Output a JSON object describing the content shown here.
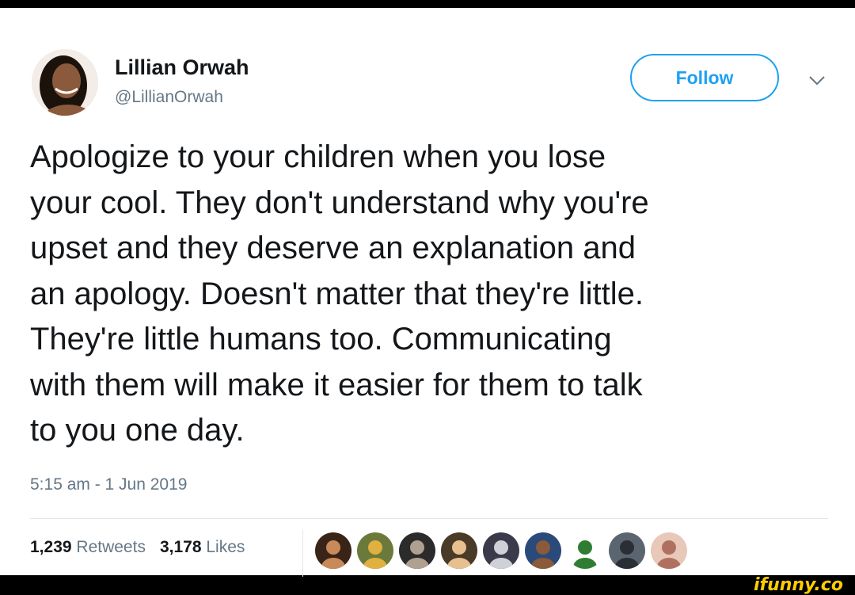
{
  "user": {
    "name": "Lillian Orwah",
    "handle": "@LillianOrwah",
    "avatar_icon": "profile-photo"
  },
  "follow_label": "Follow",
  "menu_icon": "chevron-down-icon",
  "tweet_lines": [
    "Apologize to your children when you lose",
    "your cool. They don't understand why you're",
    "upset and they deserve an explanation and",
    "an apology. Doesn't matter that they're little.",
    "They're little humans too. Communicating",
    "with them will make it easier for them to talk",
    "to you one day."
  ],
  "timestamp": "5:15 am - 1 Jun 2019",
  "stats": {
    "retweets_count": "1,239",
    "retweets_label": "Retweets",
    "likes_count": "3,178",
    "likes_label": "Likes"
  },
  "liker_avatars": [
    {
      "icon": "liker-avatar-1",
      "bg": "#3a2418",
      "fg": "#c98a5a"
    },
    {
      "icon": "liker-avatar-2",
      "bg": "#6b7a3a",
      "fg": "#e0b040"
    },
    {
      "icon": "liker-avatar-3",
      "bg": "#2b2b2b",
      "fg": "#b0a090"
    },
    {
      "icon": "liker-avatar-4",
      "bg": "#4a3a28",
      "fg": "#e8c090"
    },
    {
      "icon": "liker-avatar-5",
      "bg": "#3a3a4a",
      "fg": "#d0d0d8"
    },
    {
      "icon": "liker-avatar-6",
      "bg": "#2a4a7a",
      "fg": "#8a5a3a"
    },
    {
      "icon": "liker-avatar-7",
      "bg": "#ffffff",
      "fg": "#2e7d32"
    },
    {
      "icon": "liker-avatar-8",
      "bg": "#5a6570",
      "fg": "#2a2f35"
    },
    {
      "icon": "liker-avatar-9",
      "bg": "#e8c8b8",
      "fg": "#b07060"
    }
  ],
  "watermark": "ifunny.co",
  "colors": {
    "accent": "#1da1f2",
    "text": "#14171a",
    "muted": "#657786"
  }
}
